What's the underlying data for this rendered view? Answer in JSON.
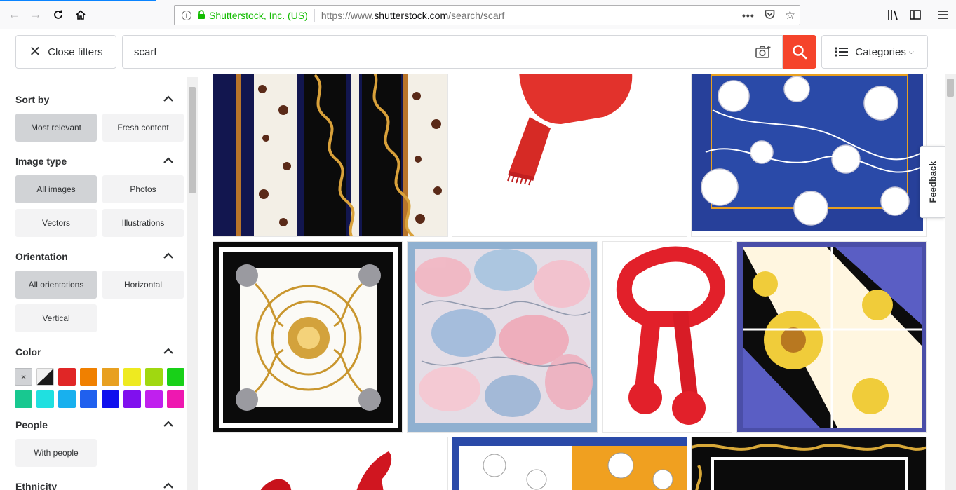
{
  "browser": {
    "identity": "Shutterstock, Inc. (US)",
    "url_prefix": "https://www.",
    "url_domain": "shutterstock.com",
    "url_path": "/search/scarf"
  },
  "header": {
    "close_filters_label": "Close filters",
    "search_value": "scarf",
    "categories_label": "Categories"
  },
  "sidebar": {
    "sort_by": {
      "title": "Sort by",
      "options": [
        "Most relevant",
        "Fresh content"
      ],
      "active": "Most relevant"
    },
    "image_type": {
      "title": "Image type",
      "options": [
        "All images",
        "Photos",
        "Vectors",
        "Illustrations"
      ],
      "active": "All images"
    },
    "orientation": {
      "title": "Orientation",
      "options": [
        "All orientations",
        "Horizontal",
        "Vertical"
      ],
      "active": "All orientations"
    },
    "color": {
      "title": "Color",
      "clear_icon": "×",
      "swatches": [
        "#e02626",
        "#f08000",
        "#e8a020",
        "#eeea20",
        "#a0d810",
        "#18d018",
        "#18c890",
        "#20e0e0",
        "#18b0ee",
        "#2060ee",
        "#1010ee",
        "#8010ee",
        "#c020ee",
        "#ee18b0"
      ]
    },
    "people": {
      "title": "People",
      "options": [
        "With people"
      ]
    },
    "ethnicity": {
      "title": "Ethnicity"
    }
  },
  "feedback_label": "Feedback",
  "colors": {
    "accent": "#f5442b",
    "active_filter": "#d1d3d6"
  }
}
